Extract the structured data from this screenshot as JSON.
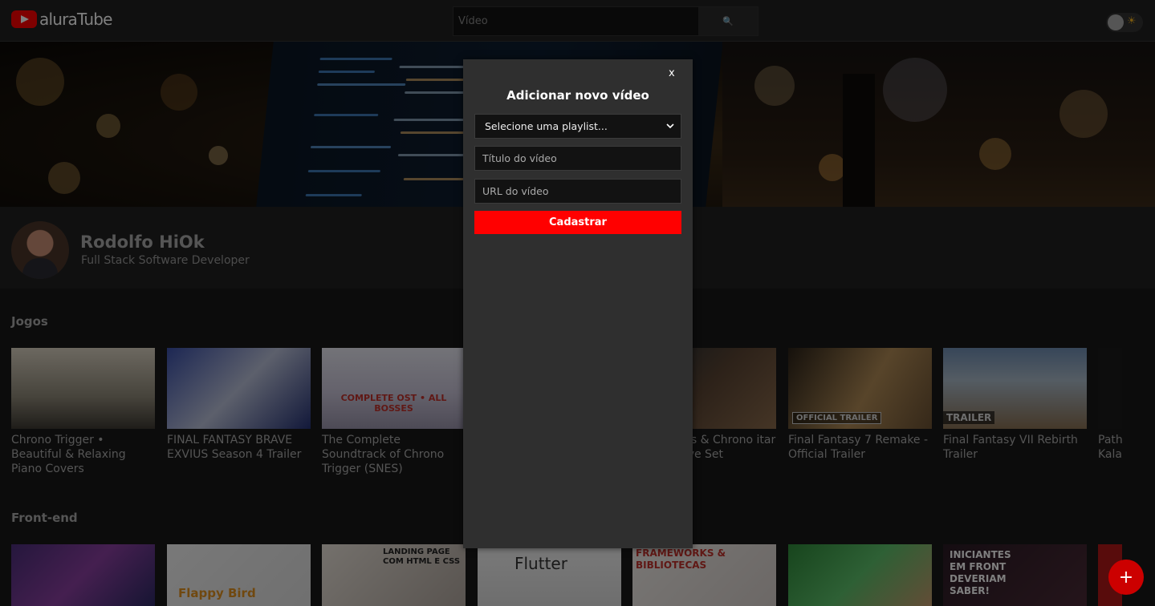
{
  "header": {
    "logo_text": "aluraTube",
    "search_placeholder": "Vídeo",
    "search_icon": "🔍",
    "theme_icon": "☀"
  },
  "profile": {
    "name": "Rodolfo HiOk",
    "job": "Full Stack Software Developer"
  },
  "playlists": [
    {
      "title": "Jogos",
      "videos": [
        {
          "title": "Chrono Trigger • Beautiful & Relaxing Piano Covers",
          "tag": ""
        },
        {
          "title": "FINAL FANTASY BRAVE EXVIUS Season 4 Trailer",
          "tag": ""
        },
        {
          "title": "The Complete Soundtrack of Chrono Trigger (SNES)",
          "tag": "COMPLETE OST • ALL BOSSES"
        },
        {
          "title": "",
          "tag": ""
        },
        {
          "title": "oss & Chrono itar Live Set",
          "tag": ""
        },
        {
          "title": "Final Fantasy 7 Remake - Official Trailer",
          "tag": "OFFICIAL TRAILER"
        },
        {
          "title": "Final Fantasy VII Rebirth Trailer",
          "tag": "TRAILER"
        },
        {
          "title": "Path Kala",
          "tag": ""
        }
      ]
    },
    {
      "title": "Front-end",
      "videos": [
        {
          "title": "",
          "tag": ""
        },
        {
          "title": "",
          "tag": "Flappy Bird"
        },
        {
          "title": "",
          "tag": "LANDING PAGE COM HTML E CSS"
        },
        {
          "title": "",
          "tag": "Flutter"
        },
        {
          "title": "",
          "tag": "FRAMEWORKS & BIBLIOTECAS"
        },
        {
          "title": "",
          "tag": ""
        },
        {
          "title": "",
          "tag": "INICIANTES EM FRONT DEVERIAM SABER!"
        }
      ]
    }
  ],
  "modal": {
    "close_label": "x",
    "title": "Adicionar novo vídeo",
    "select_label": "Selecione uma playlist...",
    "title_placeholder": "Título do vídeo",
    "url_placeholder": "URL do vídeo",
    "submit_label": "Cadastrar"
  },
  "fab": {
    "label": "+"
  },
  "colors": {
    "accent": "#ff0000",
    "background": "#181818",
    "modal": "#2f2f2f"
  }
}
